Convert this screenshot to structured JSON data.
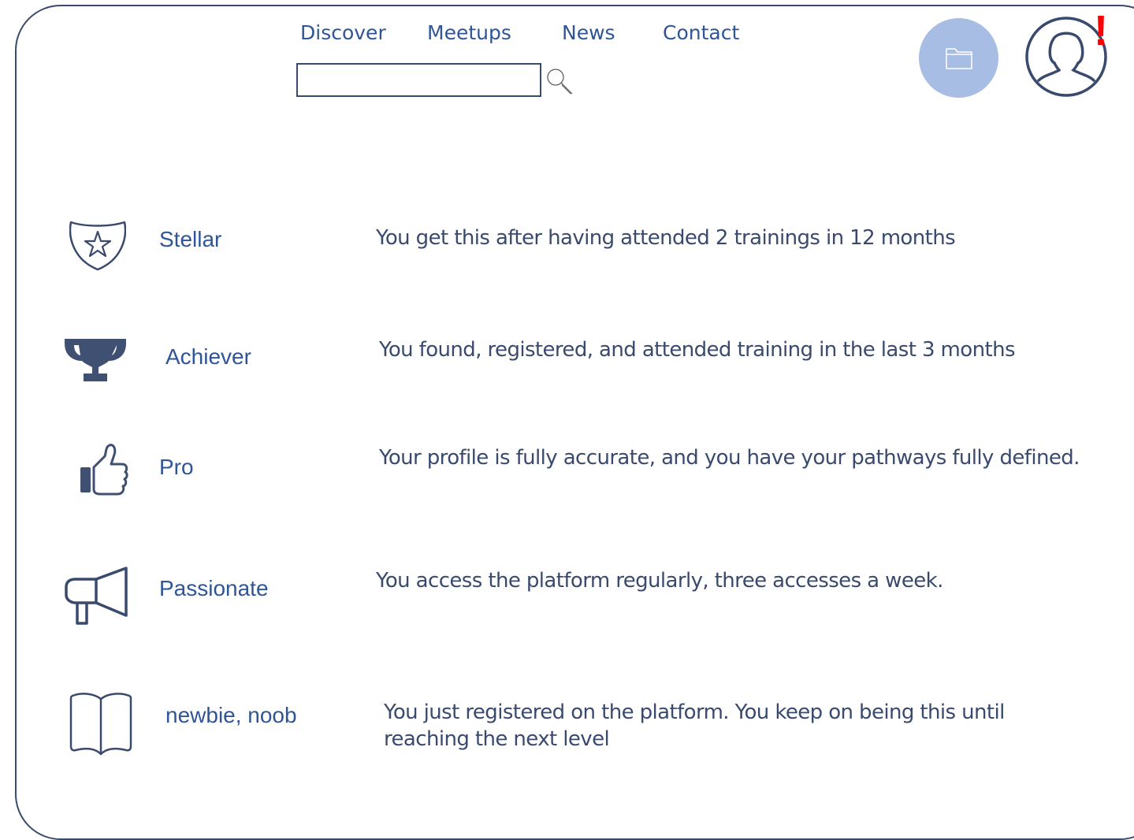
{
  "nav": {
    "items": [
      {
        "label": "Discover"
      },
      {
        "label": "Meetups"
      },
      {
        "label": "News"
      },
      {
        "label": "Contact"
      }
    ]
  },
  "search": {
    "value": "",
    "placeholder": ""
  },
  "header": {
    "folder_icon": "folder-icon",
    "avatar_icon": "user-avatar-icon",
    "alert": "!",
    "alert_color": "#ff0000",
    "accent": "#a7bde3"
  },
  "badges": [
    {
      "icon": "shield-star-icon",
      "name": "Stellar",
      "description": "You get this after having attended 2 trainings in 12 months"
    },
    {
      "icon": "trophy-icon",
      "name": "Achiever",
      "description": "You found, registered, and attended training in the last 3 months"
    },
    {
      "icon": "thumbs-up-icon",
      "name": "Pro",
      "description": "Your profile is fully accurate, and you have your pathways fully defined."
    },
    {
      "icon": "megaphone-icon",
      "name": "Passionate",
      "description": "You access the platform regularly, three accesses a week."
    },
    {
      "icon": "open-book-icon",
      "name": "newbie, noob",
      "description": "You just registered on the platform. You keep on being this until reaching the next level"
    }
  ],
  "colors": {
    "link": "#2f5597",
    "text": "#3a4a6e",
    "frame": "#3a4a6e"
  }
}
